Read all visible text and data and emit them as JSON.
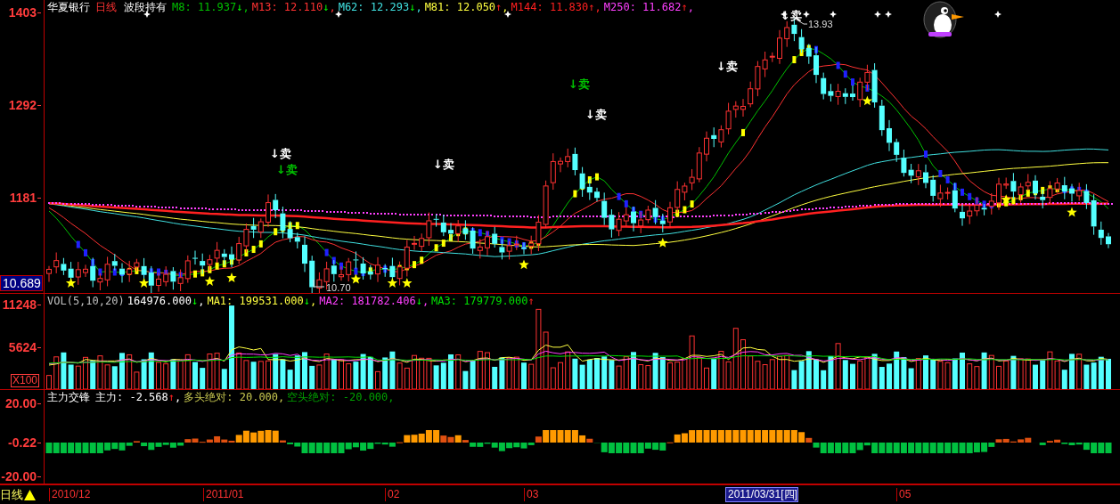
{
  "title_bar": {
    "stock": "华夏银行",
    "period": "日线",
    "indicator": "波段持有",
    "legend": [
      {
        "text": "M8: 11.937",
        "arrow": "↓",
        "rising": false,
        "suffix": ",",
        "color": "#00c000"
      },
      {
        "text": "M13: 12.110",
        "arrow": "↓",
        "rising": false,
        "suffix": ",",
        "color": "#ff3232"
      },
      {
        "text": "M62: 12.293",
        "arrow": "↓",
        "rising": false,
        "suffix": ",",
        "color": "#40e0e0"
      },
      {
        "text": "M81: 12.050",
        "arrow": "↑",
        "rising": true,
        "suffix": ",",
        "color": "#ffff40"
      },
      {
        "text": "M144: 11.830",
        "arrow": "↑",
        "rising": true,
        "suffix": ",",
        "color": "#ff2020"
      },
      {
        "text": "M250: 11.682",
        "arrow": "↑",
        "rising": true,
        "suffix": ",",
        "color": "#ff40ff"
      }
    ]
  },
  "price_axis": {
    "ticks": [
      "1403",
      "1292",
      "1181"
    ],
    "current_price": "10.689"
  },
  "price_chart": {
    "annotations": [
      {
        "text": "↓卖",
        "color": "#ffffff"
      },
      {
        "text": "↓卖",
        "color": "#00c000"
      },
      {
        "text": "↓卖",
        "color": "#ffffff"
      },
      {
        "text": "↓卖",
        "color": "#00c000"
      },
      {
        "text": "↓卖",
        "color": "#ffffff"
      },
      {
        "text": "↓卖",
        "color": "#ffffff"
      },
      {
        "text": "↓卖",
        "color": "#ffffff"
      }
    ],
    "high_label": "13.93",
    "low_label": "10.70"
  },
  "volume_pane": {
    "name": "VOL(5,10,20)",
    "legend": [
      {
        "text": "164976.000",
        "arrow": "↓",
        "rising": false,
        "suffix": ",",
        "color": "#ffffff"
      },
      {
        "text": "MA1: 199531.000",
        "arrow": "↓",
        "rising": false,
        "suffix": ",",
        "color": "#ffff40"
      },
      {
        "text": "MA2: 181782.406",
        "arrow": "↓",
        "rising": false,
        "suffix": ",",
        "color": "#ff40ff"
      },
      {
        "text": "MA3: 179779.000",
        "arrow": "↑",
        "rising": true,
        "color": "#00e000"
      }
    ],
    "axis_ticks": [
      "11248",
      "5624"
    ],
    "unit": "X100"
  },
  "indicator_pane": {
    "name": "主力交锋",
    "legend": [
      {
        "text": "主力: -2.568",
        "arrow": "↑",
        "rising": true,
        "suffix": ",",
        "color": "#ffffff"
      },
      {
        "text": "多头绝对: 20.000",
        "suffix": ",",
        "color": "#c8c850"
      },
      {
        "text": "空头绝对: -20.000",
        "suffix": ",",
        "color": "#00a000"
      }
    ],
    "axis_ticks": [
      "20.00",
      "-0.22",
      "-20.00"
    ]
  },
  "date_axis": {
    "period_button": "日线",
    "labels": [
      {
        "text": "2010/12",
        "selected": false
      },
      {
        "text": "2011/01",
        "selected": false
      },
      {
        "text": "02",
        "selected": false
      },
      {
        "text": "03",
        "selected": false
      },
      {
        "text": "2011/03/31[四]",
        "selected": true
      },
      {
        "text": "05",
        "selected": false
      }
    ]
  }
}
